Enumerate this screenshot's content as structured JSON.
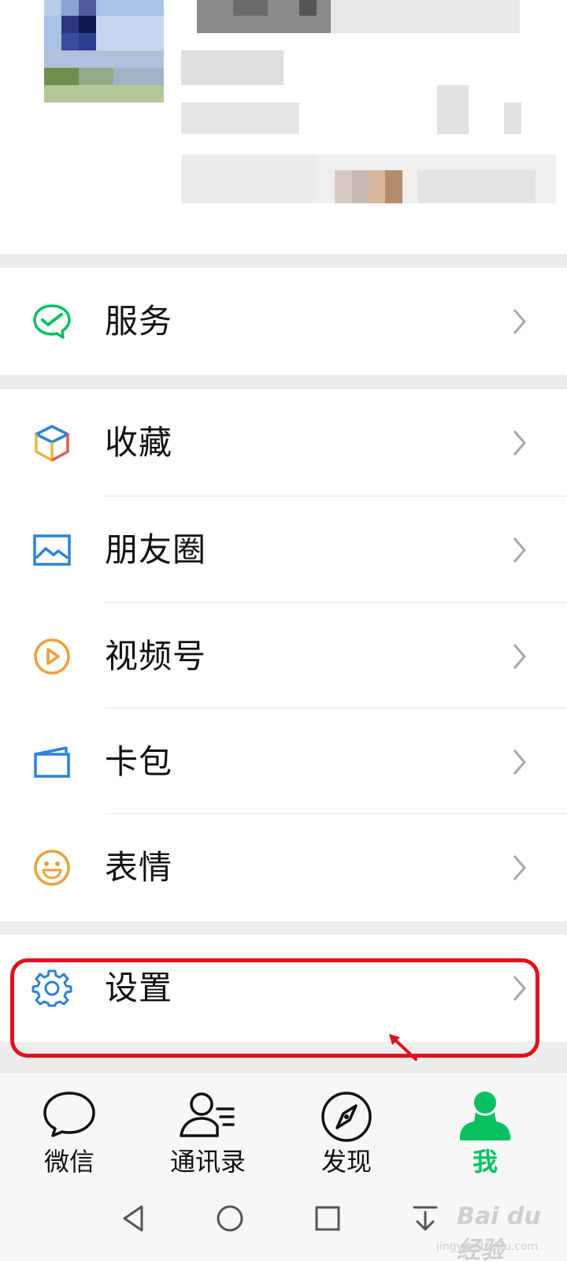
{
  "menu": {
    "service": {
      "label": "服务"
    },
    "favorites": {
      "label": "收藏"
    },
    "moments": {
      "label": "朋友圈"
    },
    "channels": {
      "label": "视频号"
    },
    "cards": {
      "label": "卡包"
    },
    "stickers": {
      "label": "表情"
    },
    "settings": {
      "label": "设置"
    }
  },
  "tabbar": {
    "tabs": [
      {
        "label": "微信",
        "icon": "chat-bubble-icon",
        "active": false
      },
      {
        "label": "通讯录",
        "icon": "contacts-icon",
        "active": false
      },
      {
        "label": "发现",
        "icon": "compass-icon",
        "active": false
      },
      {
        "label": "我",
        "icon": "person-icon",
        "active": true
      }
    ]
  },
  "watermark": {
    "brand": "Bai du 经验",
    "url": "jingyan.baidu.com"
  },
  "colors": {
    "accent_green": "#07c160",
    "highlight_red": "#e0111b",
    "icon_blue": "#2c82d6",
    "icon_orange": "#e9a23b"
  }
}
